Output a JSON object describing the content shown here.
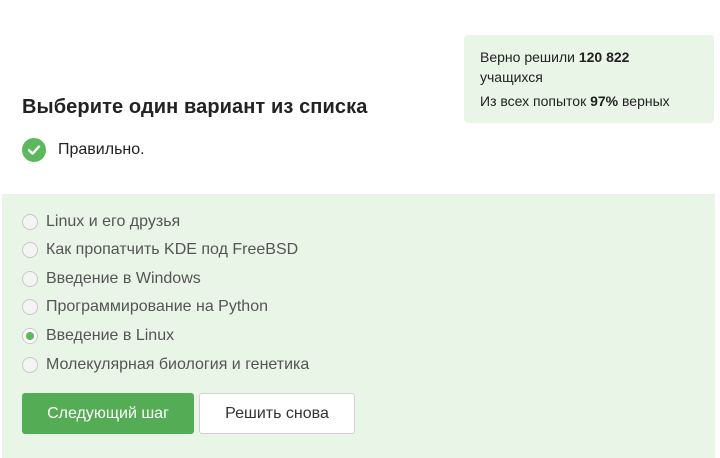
{
  "stats": {
    "solved_prefix": "Верно решили",
    "solved_count": "120 822",
    "solved_suffix": "учащихся",
    "attempts_prefix": "Из всех попыток",
    "attempts_percent": "97%",
    "attempts_suffix": "верных"
  },
  "question": {
    "title": "Выберите один вариант из списка"
  },
  "feedback": {
    "text": "Правильно.",
    "icon": "check-circle-icon",
    "color": "#5cb85c"
  },
  "options": [
    {
      "label": "Linux и его друзья",
      "selected": false
    },
    {
      "label": "Как пропатчить KDE под FreeBSD",
      "selected": false
    },
    {
      "label": "Введение в Windows",
      "selected": false
    },
    {
      "label": "Программирование на Python",
      "selected": false
    },
    {
      "label": "Введение в Linux",
      "selected": true
    },
    {
      "label": "Молекулярная биология и генетика",
      "selected": false
    }
  ],
  "actions": {
    "next_label": "Следующий шаг",
    "retry_label": "Решить снова"
  },
  "colors": {
    "accent": "#54ad54",
    "panel_bg": "#e9f5e7"
  }
}
